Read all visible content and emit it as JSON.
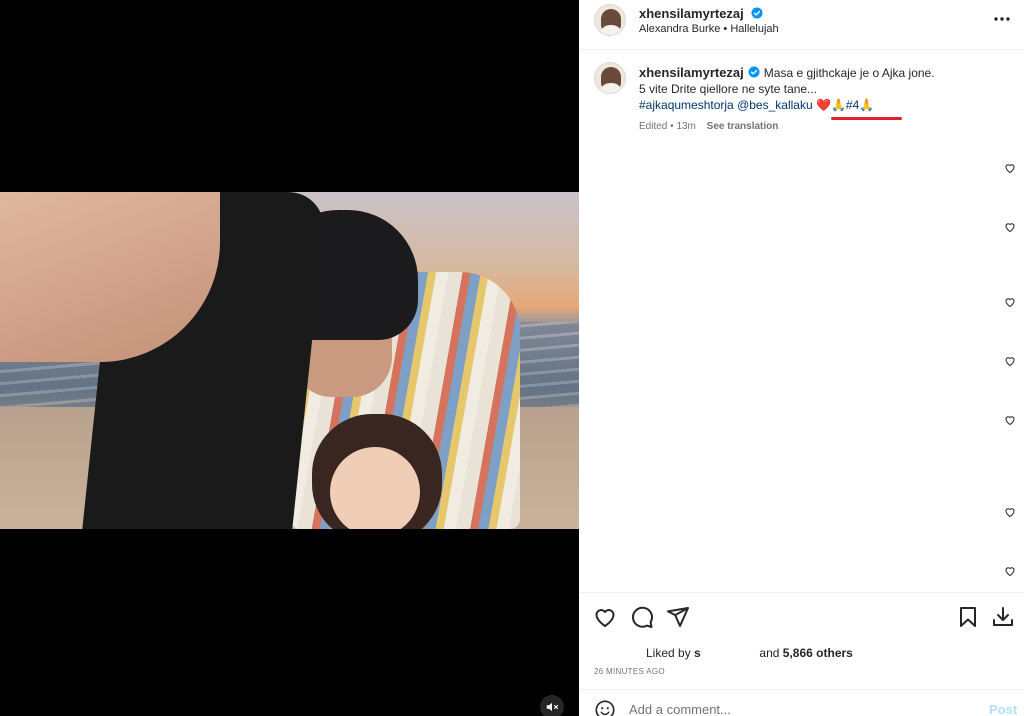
{
  "post": {
    "username": "xhensilamyrtezaj",
    "audio_artist": "Alexandra Burke",
    "audio_separator": "•",
    "audio_track": "Hallelujah",
    "more_icon": "more-horizontal-icon"
  },
  "caption": {
    "username": "xhensilamyrtezaj",
    "line1": "Masa e gjithckaje je o Ajka jone.",
    "line2": "5 vite Drite qiellore ne syte tane...",
    "hashtag": "#ajkaqumeshtorja",
    "mention": "@bes_kallaku",
    "emoji_heart": "❤️",
    "emoji_pray1": "🙏",
    "hashtag2": "#4",
    "emoji_pray2": "🙏",
    "edited": "Edited",
    "edited_sep": "•",
    "time": "13m",
    "see_translation": "See translation"
  },
  "comments_like_icons": 7,
  "actions": {
    "like_icon": "heart-icon",
    "comment_icon": "comment-icon",
    "share_icon": "send-icon",
    "save_icon": "bookmark-icon",
    "download_icon": "download-icon"
  },
  "likes": {
    "prefix": "Liked by",
    "user": "s",
    "and": "and",
    "others": "5,866 others"
  },
  "time_ago": "26 MINUTES AGO",
  "comment_box": {
    "placeholder": "Add a comment...",
    "post_label": "Post"
  },
  "colors": {
    "accent_link": "#00376b",
    "verified": "#0095f6",
    "underline_annotation": "#e0212e",
    "post_disabled": "#b2dffc"
  }
}
